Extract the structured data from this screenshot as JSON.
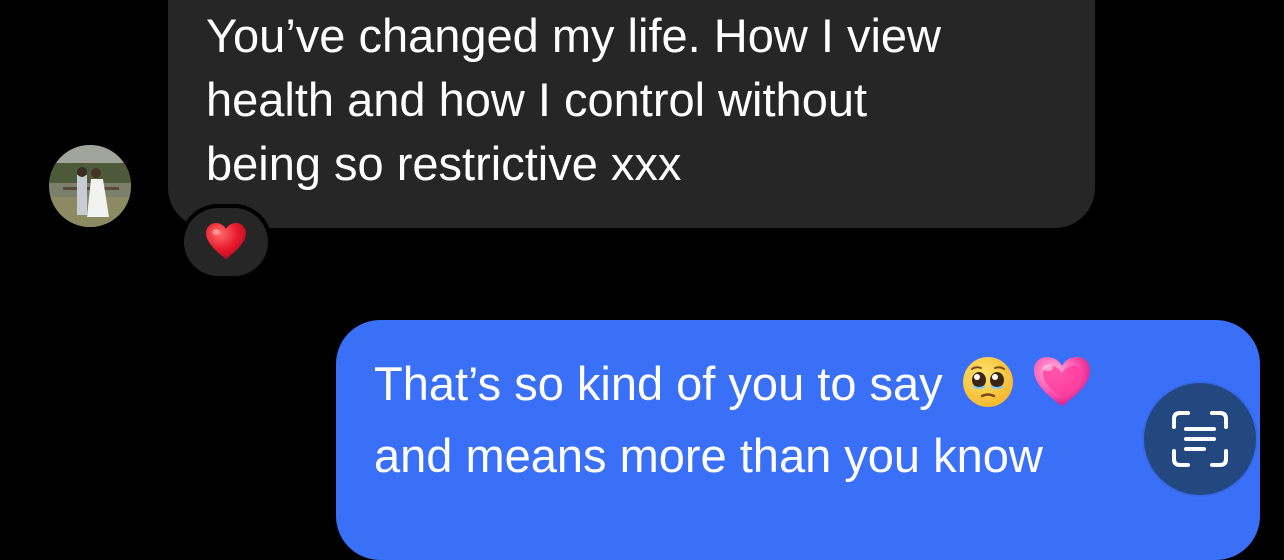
{
  "conversation": {
    "incoming_message": {
      "text": "You’ve changed my life. How I view\nhealth and how I control without\nbeing so restrictive xxx",
      "reaction": "heart-emoji"
    },
    "outgoing_message": {
      "line1": "That’s so kind of you to say",
      "line2": "and means more than you know",
      "emojis": [
        "pleading-face-emoji",
        "growing-heart-emoji"
      ]
    }
  },
  "overlay": {
    "scan_text_icon": "live-text-scan-icon"
  },
  "colors": {
    "background": "#000000",
    "incoming_bubble": "#262626",
    "outgoing_bubble": "#3a6ff7",
    "scan_button": "#23477f"
  }
}
